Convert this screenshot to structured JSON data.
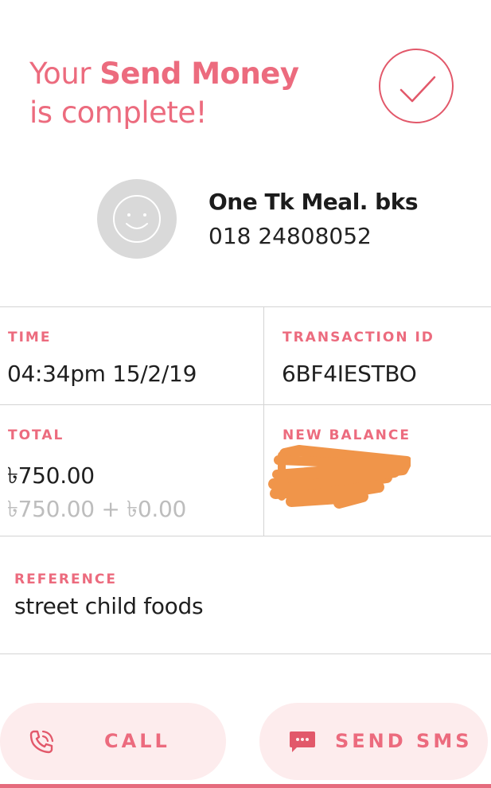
{
  "header": {
    "line1_prefix": "Your",
    "line1_bold": "Send Money",
    "line2": "is complete!"
  },
  "recipient": {
    "name": "One Tk Meal. bks",
    "phone": "018 24808052"
  },
  "details": {
    "time_label": "TIME",
    "time_value": "04:34pm 15/2/19",
    "transaction_id_label": "TRANSACTION ID",
    "transaction_id_value": "6BF4IESTBO",
    "total_label": "TOTAL",
    "total_value": "৳750.00",
    "total_breakdown": "৳750.00 + ৳0.00",
    "new_balance_label": "NEW BALANCE"
  },
  "reference": {
    "label": "REFERENCE",
    "value": "street child foods"
  },
  "actions": {
    "call_label": "CALL",
    "sms_label": "SEND SMS"
  },
  "colors": {
    "accent": "#ec6b7e",
    "button_bg": "#fdeced",
    "redaction": "#f0954a"
  },
  "icons": [
    "check-icon",
    "smiley-avatar-icon",
    "phone-call-icon",
    "chat-bubble-icon"
  ]
}
